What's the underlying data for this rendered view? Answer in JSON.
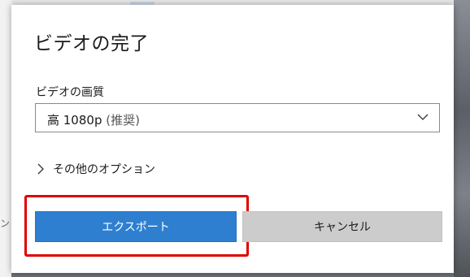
{
  "background": {
    "left_text": "ン"
  },
  "dialog": {
    "title": "ビデオの完了",
    "quality": {
      "label": "ビデオの画質",
      "selected_main": "高 1080p",
      "selected_suffix": " (推奨)"
    },
    "more_options_label": "その他のオプション",
    "buttons": {
      "export_label": "エクスポート",
      "cancel_label": "キャンセル"
    }
  },
  "colors": {
    "accent": "#2e7fd0",
    "highlight": "#e00000",
    "cancel_bg": "#cccccc"
  },
  "icons": {
    "select_chevron": "chevron-down-icon",
    "more_options_chevron": "chevron-right-icon"
  }
}
